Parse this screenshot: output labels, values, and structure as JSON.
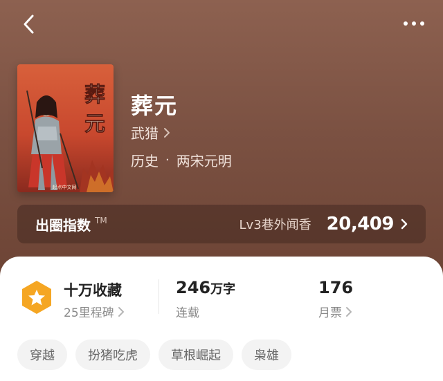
{
  "header": {
    "back": "back",
    "more": "more"
  },
  "book": {
    "title": "葬元",
    "author": "武猎",
    "genre_primary": "历史",
    "genre_separator": "·",
    "genre_secondary": "两宋元明",
    "cover_title_line1": "葬",
    "cover_title_line2": "元",
    "cover_publisher": "起点中文网"
  },
  "index_card": {
    "label": "出圈指数",
    "tm": "TM",
    "level": "Lv3巷外闻香",
    "value": "20,409"
  },
  "stats": {
    "collect_title": "十万收藏",
    "collect_sub": "25里程碑",
    "words_number": "246",
    "words_unit": "万字",
    "words_sub": "连载",
    "tickets_number": "176",
    "tickets_sub": "月票"
  },
  "tags": [
    "穿越",
    "扮猪吃虎",
    "草根崛起",
    "枭雄"
  ],
  "colors": {
    "badge": "#f5a623",
    "accent_bg": "#7b5142"
  }
}
